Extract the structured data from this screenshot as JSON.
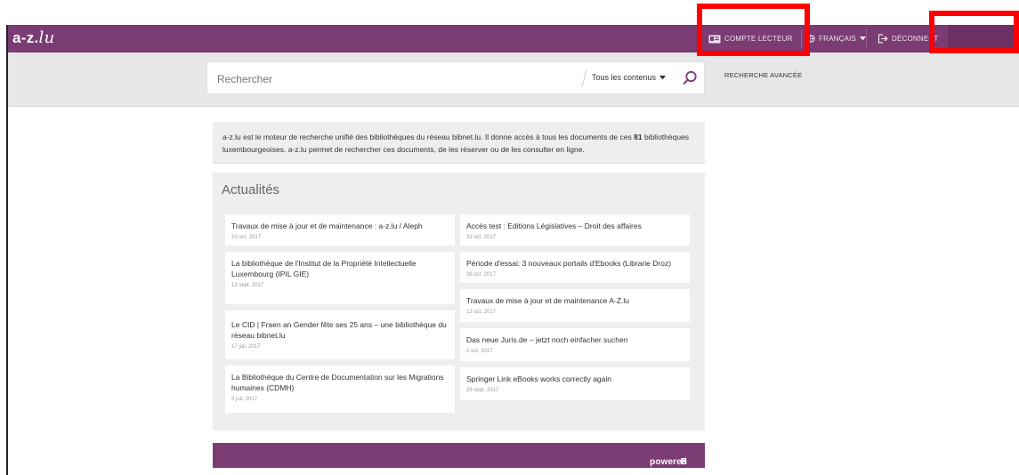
{
  "header": {
    "logo_main": "a-z.",
    "logo_suffix": "lu",
    "account_label": "COMPTE LECTEUR",
    "language_label": "FRANÇAIS",
    "logout_label": "DÉCONNECT"
  },
  "search": {
    "placeholder": "Rechercher",
    "scope_label": "Tous les contenus",
    "advanced_label": "RECHERCHE AVANCÉE"
  },
  "intro": {
    "text_before": "a-z.lu est le moteur de recherche unifié des bibliothèques du réseau bibnet.lu. Il donne accès à tous les documents de ces ",
    "count": "81",
    "text_after": " bibliothèques luxembourgeoises. a-z.lu permet de rechercher ces documents, de les réserver ou de les consulter en ligne."
  },
  "news": {
    "title": "Actualités",
    "left": [
      {
        "title": "Travaux de mise à jour et de maintenance : a-z.lu / Aleph",
        "date": "10 oct. 2017"
      },
      {
        "title": "La bibliothèque de l'Institut de la Propriété Intellectuelle Luxembourg (IPIL GIE)",
        "date": "13 sept. 2017"
      },
      {
        "title": "Le CID | Fraen an Gender fête ses 25 ans – une bibliothèque du réseau bibnet.lu",
        "date": "17 juil. 2017"
      },
      {
        "title": "La Bibliothèque du Centre de Documentation sur les Migrations humaines (CDMH)",
        "date": "3 juil. 2017"
      }
    ],
    "right": [
      {
        "title": "Accès test : Editions Législatives – Droit des affaires",
        "date": "31 oct. 2017"
      },
      {
        "title": "Période d'essai: 3 nouveaux portails d'Ebooks (Librarie Droz)",
        "date": "26 oct. 2017"
      },
      {
        "title": "Travaux de mise à jour et de maintenance A-Z.lu",
        "date": "13 oct. 2017"
      },
      {
        "title": "Das neue Juris.de – jetzt noch einfacher suchen",
        "date": "2 oct. 2017"
      },
      {
        "title": "Springer Link eBooks works correctly again",
        "date": "29 sept. 2017"
      }
    ]
  },
  "footer": {
    "powered_label": "powered by",
    "powered_mark": "B"
  },
  "colors": {
    "brand": "#7b3b73",
    "highlight": "#ff0000",
    "band": "#e7e7e7",
    "panel": "#eeeeee"
  }
}
